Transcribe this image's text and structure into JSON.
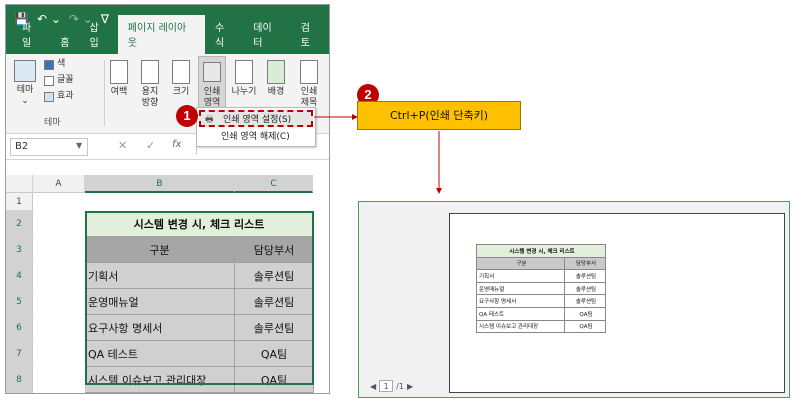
{
  "excel": {
    "tabs": [
      "파일",
      "홈",
      "삽입",
      "페이지 레이아웃",
      "수식",
      "데이터",
      "검토"
    ],
    "ribbon": {
      "theme_label": "테마",
      "color_label": "색",
      "font_label": "글꼴",
      "effect_label": "효과",
      "group_theme": "테마",
      "margin_label": "여백",
      "orientation_label_1": "용지",
      "orientation_label_2": "방향",
      "size_label": "크기",
      "print_area_label_1": "인쇄",
      "print_area_label_2": "영역",
      "breaks_label": "나누기",
      "background_label": "배경",
      "print_titles_label_1": "인쇄",
      "print_titles_label_2": "제목"
    },
    "dropdown": {
      "set_print_area": "인쇄 영역 설정(S)",
      "clear_print_area": "인쇄 영역 해제(C)"
    },
    "name_box": "B2",
    "formula_fx": "fx",
    "col_headers": [
      "A",
      "B",
      "C"
    ],
    "row_headers": [
      "1",
      "2",
      "3",
      "4",
      "5",
      "6",
      "7",
      "8"
    ],
    "table": {
      "title": "시스템 변경 시, 체크 리스트",
      "header": [
        "구분",
        "담당부서"
      ],
      "rows": [
        [
          "기획서",
          "솔루션팀"
        ],
        [
          "운영매뉴얼",
          "솔루션팀"
        ],
        [
          "요구사항 명세서",
          "솔루션팀"
        ],
        [
          "QA 테스트",
          "QA팀"
        ],
        [
          "시스템 이슈보고 관리대장",
          "QA팀"
        ]
      ]
    }
  },
  "badges": {
    "one": "1",
    "two": "2"
  },
  "callout": "Ctrl+P(인쇄 단축키)",
  "preview": {
    "page_number": "1",
    "page_total": "/1"
  },
  "colors": {
    "excel_green": "#217346",
    "badge_red": "#c00000",
    "callout_yellow": "#ffc000"
  }
}
